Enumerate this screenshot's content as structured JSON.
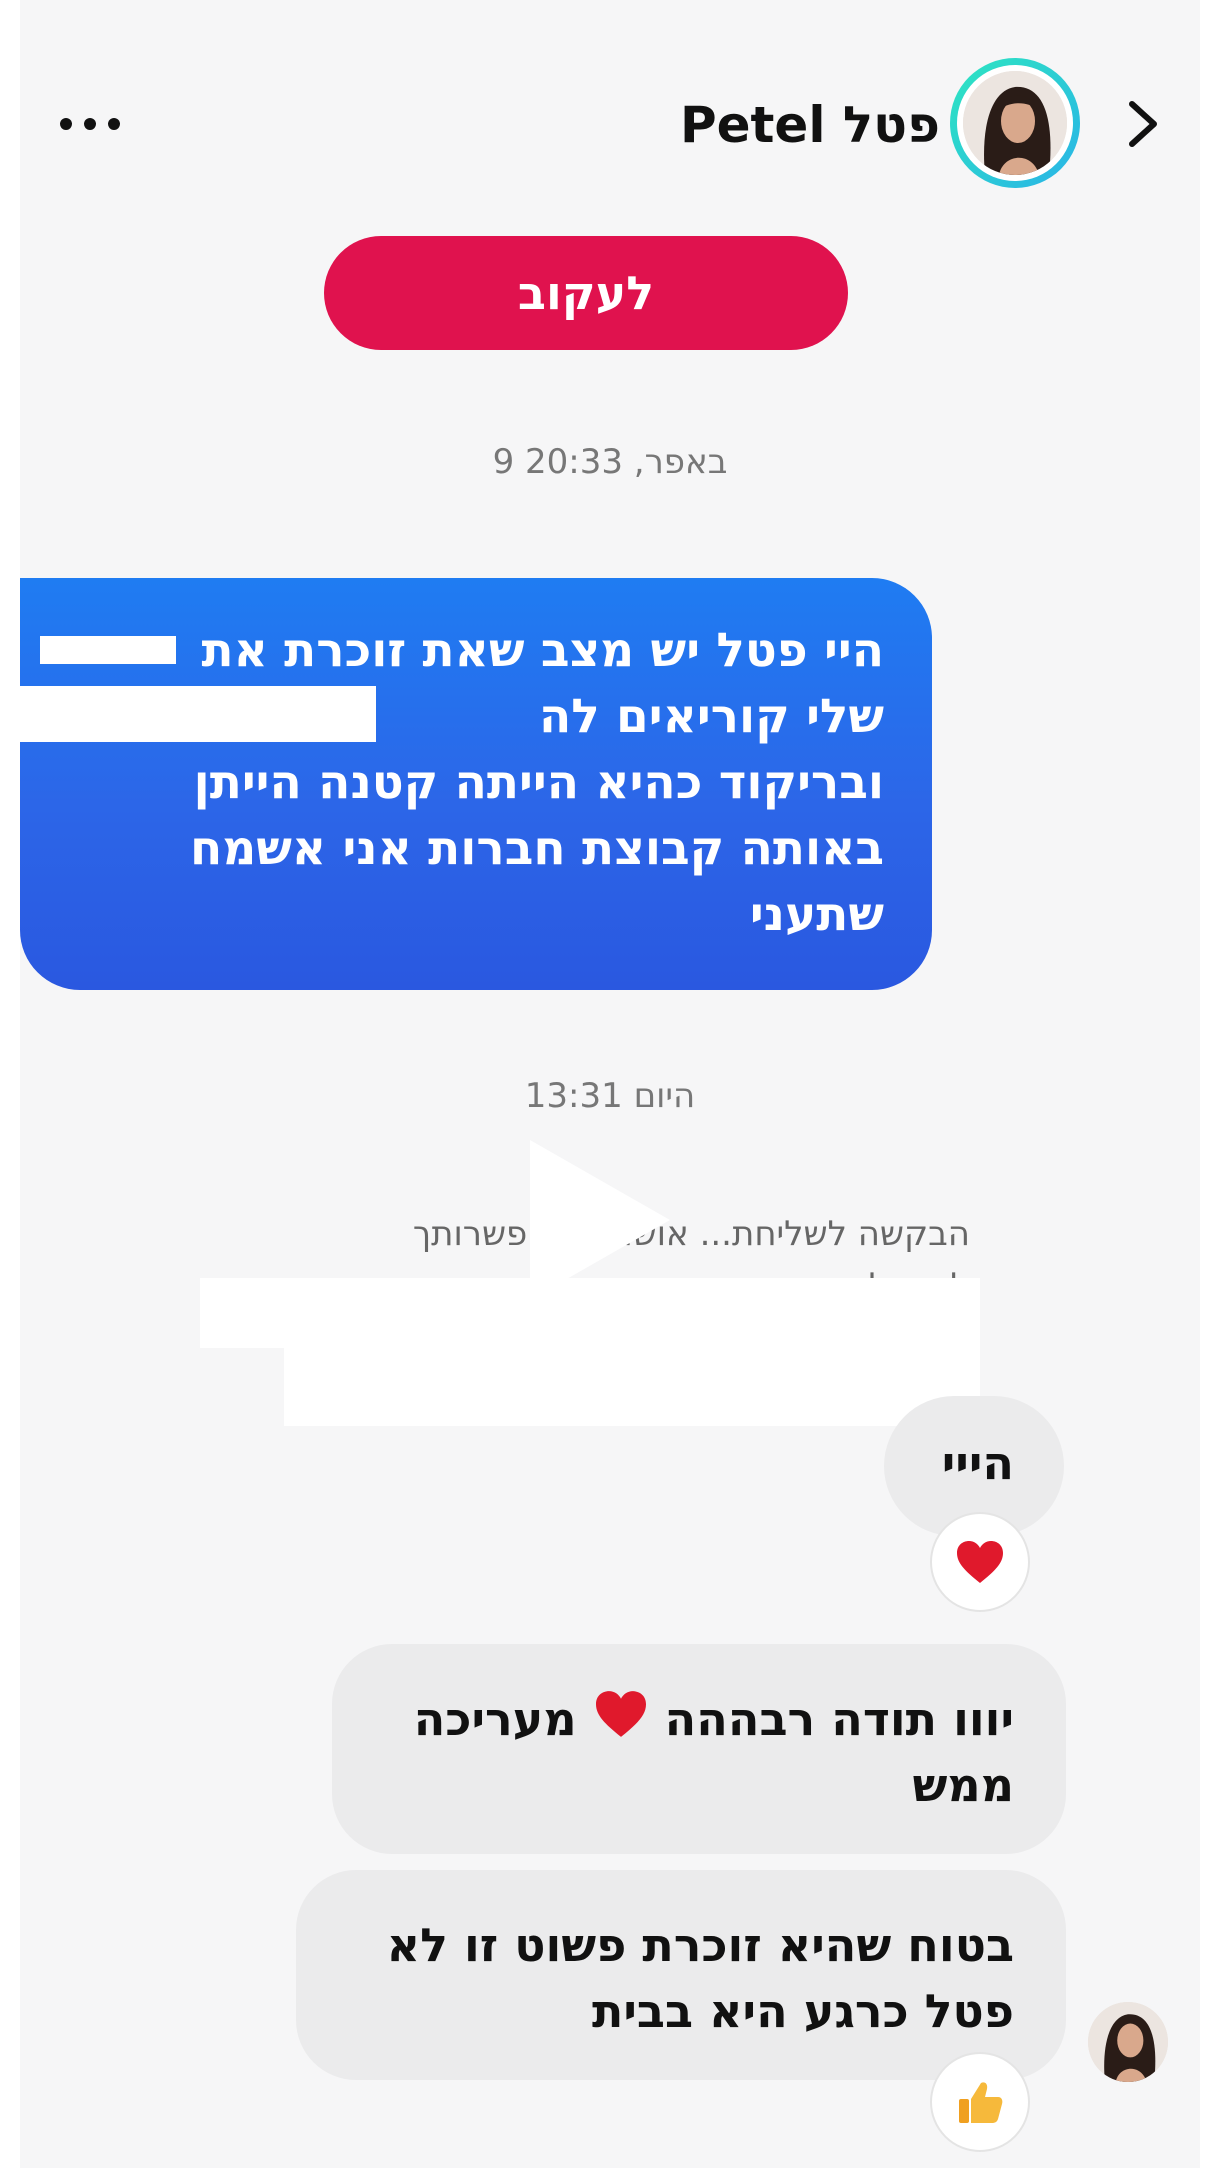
{
  "header": {
    "contact_name": "Petel פטל"
  },
  "follow_button": {
    "label": "לעקוב"
  },
  "timestamps": {
    "first": "באפר, 20:33 9",
    "second": "היום 13:31"
  },
  "outgoing_message": {
    "lines": [
      "היי פטל יש מצב שאת זוכרת את",
      "שלי קוריאים לה",
      "ובריקוד כהיא הייתה קטנה הייתן",
      "באותה קבוצת חברות אני אשמח",
      "שתעני"
    ]
  },
  "system_notice": {
    "line1": "הבקשה לשליחת... אושרה. באפשרותך",
    "line2": "להגדיל..."
  },
  "incoming_messages": {
    "hey": "הייי",
    "msg2_line1_a": "יווו תודה רבההה",
    "msg2_line1_b": "מעריכה",
    "msg2_line2": "ממש",
    "msg3_line1": "בטוח שהיא זוכרת  פשוט זו לא",
    "msg3_line2": "פטל כרגע היא בבית"
  },
  "reactions": {
    "hey_reaction": "heart-icon",
    "msg3_reaction": "thumbs-up-icon"
  },
  "colors": {
    "follow_button": "#e0124e",
    "outgoing_bubble": "#2c66e8",
    "incoming_bubble": "#ebebec",
    "background": "#f6f6f7",
    "avatar_ring": "#29b3e8"
  }
}
